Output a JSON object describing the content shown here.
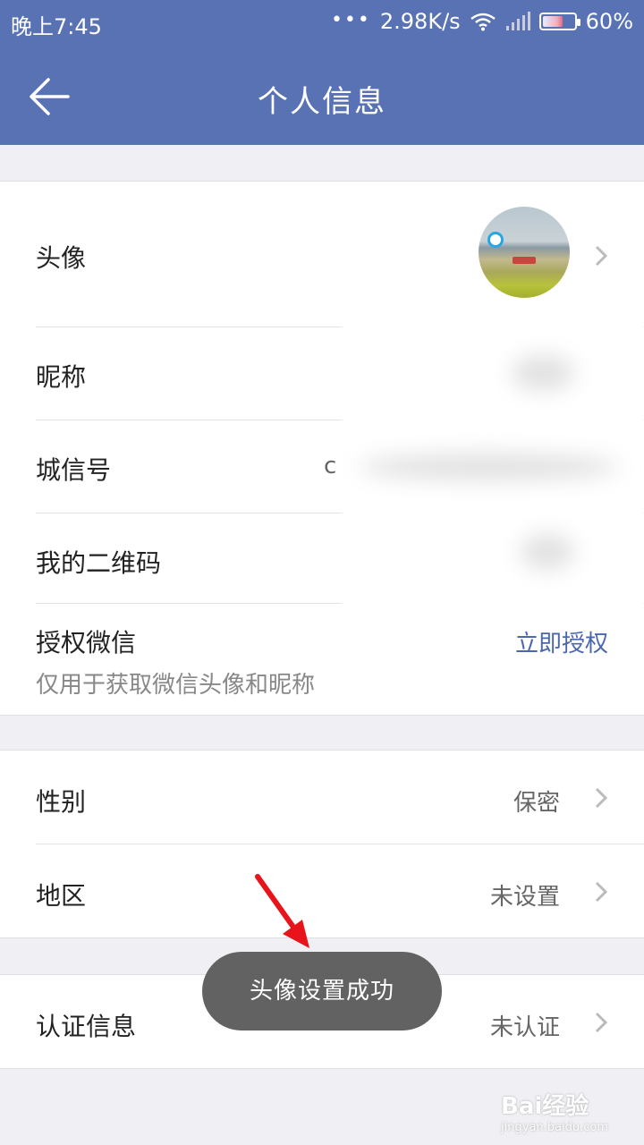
{
  "status_bar": {
    "time": "晚上7:45",
    "network_speed": "2.98K/s",
    "battery_percent_text": "60%",
    "battery_level": 0.6,
    "icons": [
      "dots-icon",
      "wifi-icon",
      "signal-icon",
      "battery-icon"
    ]
  },
  "nav": {
    "title": "个人信息",
    "back_icon": "arrow-left-icon"
  },
  "profile": {
    "avatar_label": "头像",
    "nickname_label": "昵称",
    "chengxin_label": "城信号",
    "chengxin_value_partial": "c",
    "qrcode_label": "我的二维码",
    "wechat_label": "授权微信",
    "wechat_sub": "仅用于获取微信头像和昵称",
    "wechat_action": "立即授权"
  },
  "details": {
    "gender_label": "性别",
    "gender_value": "保密",
    "region_label": "地区",
    "region_value": "未设置"
  },
  "verify": {
    "label": "认证信息",
    "value": "未认证"
  },
  "toast": {
    "text": "头像设置成功"
  },
  "watermark": {
    "brand": "Bai经验",
    "url": "jingyan.baidu.com"
  },
  "colors": {
    "header": "#5872b4",
    "link": "#4a67b0",
    "background": "#efeff4",
    "annotation_arrow": "#e8141c"
  }
}
